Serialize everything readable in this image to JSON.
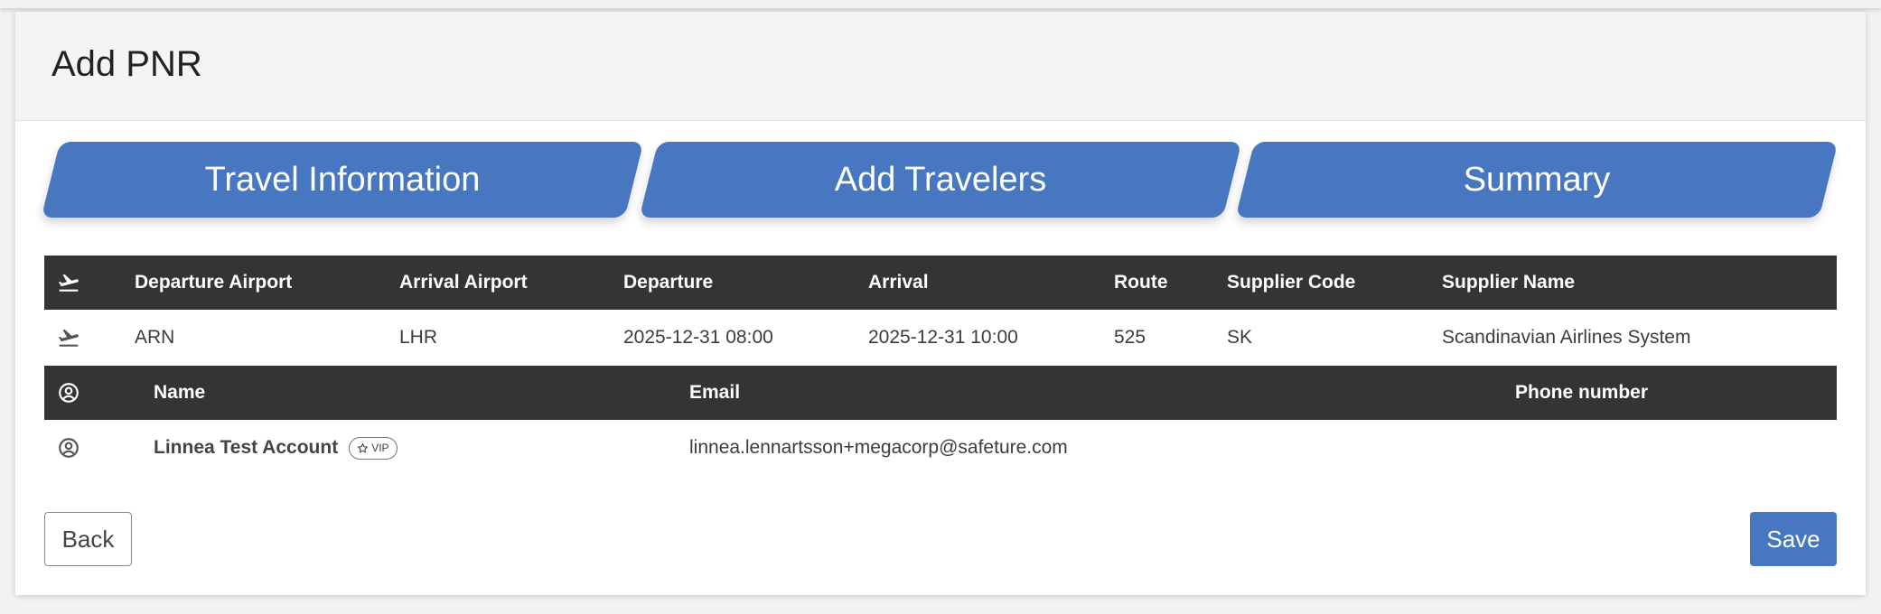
{
  "page": {
    "title": "Add PNR"
  },
  "steps": [
    {
      "label": "Travel Information"
    },
    {
      "label": "Add Travelers"
    },
    {
      "label": "Summary"
    }
  ],
  "flights": {
    "headers": [
      "Departure Airport",
      "Arrival Airport",
      "Departure",
      "Arrival",
      "Route",
      "Supplier Code",
      "Supplier Name"
    ],
    "rows": [
      {
        "departure_airport": "ARN",
        "arrival_airport": "LHR",
        "departure": "2025-12-31 08:00",
        "arrival": "2025-12-31 10:00",
        "route": "525",
        "supplier_code": "SK",
        "supplier_name": "Scandinavian Airlines System"
      }
    ]
  },
  "travelers": {
    "headers": [
      "Name",
      "Email",
      "Phone number"
    ],
    "rows": [
      {
        "name": "Linnea Test Account",
        "badge": "VIP",
        "email": "linnea.lennartsson+megacorp@safeture.com",
        "phone": ""
      }
    ]
  },
  "actions": {
    "back": "Back",
    "save": "Save"
  },
  "colors": {
    "accent": "#4877c2",
    "header_dark": "#333436"
  },
  "icons": {
    "flight": "airplane-takeoff-icon",
    "traveler": "user-circle-icon",
    "vip": "star-icon"
  }
}
